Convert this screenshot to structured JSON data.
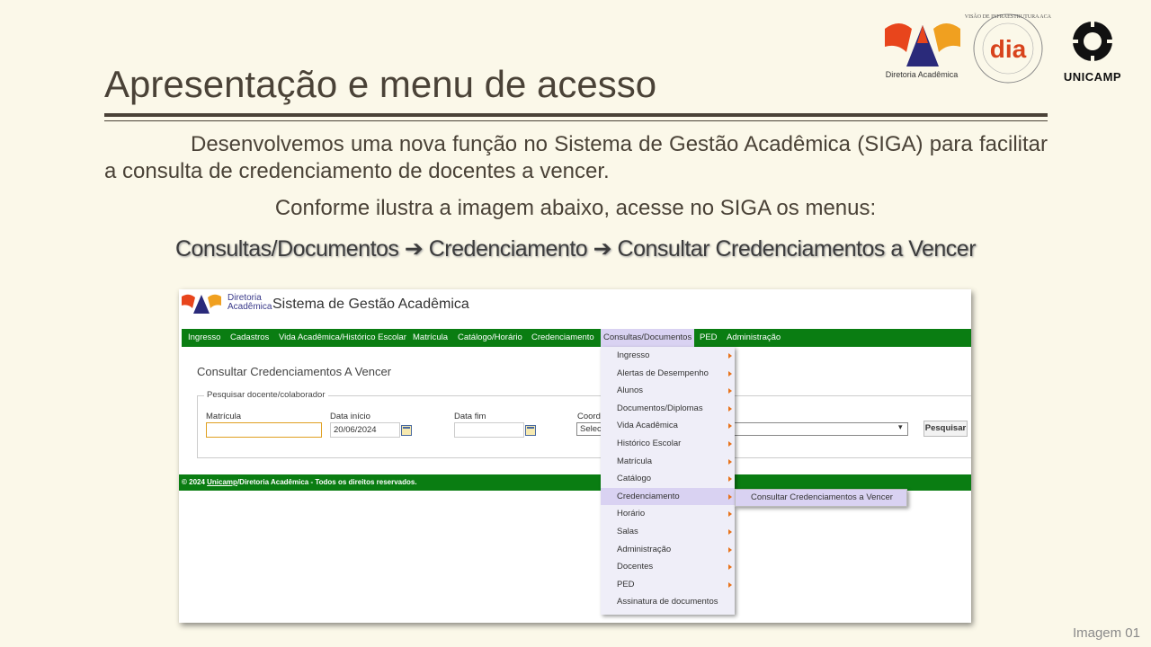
{
  "slide": {
    "title": "Apresentação e menu de acesso",
    "paragraph": "Desenvolvemos uma nova função no Sistema de Gestão Acadêmica (SIGA) para facilitar a consulta de credenciamento de docentes a vencer.",
    "conforme": "Conforme ilustra a imagem abaixo, acesse no SIGA os menus:",
    "path": "Consultas/Documentos ➔ Credenciamento ➔ Consultar Credenciamentos a Vencer",
    "caption": "Imagem 01"
  },
  "logos": {
    "diretoria_label": "Diretoria Acadêmica",
    "dia_label": "dia",
    "dia_ring": "D.I.A. · DIVISÃO DE INFRAESTRUTURA ACADÊMICA ·",
    "unicamp_label": "UNICAMP"
  },
  "app": {
    "logo_line1": "Diretoria",
    "logo_line2": "Acadêmica",
    "title": "Sistema de Gestão Acadêmica",
    "menu": [
      "Ingresso",
      "Cadastros",
      "Vida Acadêmica/Histórico Escolar",
      "Matrícula",
      "Catálogo/Horário",
      "Credenciamento",
      "Consultas/Documentos",
      "PED",
      "Administração"
    ],
    "page_heading": "Consultar Credenciamentos A Vencer",
    "legend": "Pesquisar docente/colaborador",
    "fields": {
      "matricula_label": "Matrícula",
      "matricula_value": "",
      "data_inicio_label": "Data início",
      "data_inicio_value": "20/06/2024",
      "data_fim_label": "Data fim",
      "data_fim_value": "",
      "coord_label": "Coord",
      "coord_value": "Selec"
    },
    "search_button": "Pesquisar",
    "footer_prefix": "© 2024 ",
    "footer_link": "Unicamp",
    "footer_suffix": "/Diretoria Acadêmica - Todos os direitos reservados.",
    "dropdown": [
      "Ingresso",
      "Alertas de Desempenho",
      "Alunos",
      "Documentos/Diplomas",
      "Vida Acadêmica",
      "Histórico Escolar",
      "Matrícula",
      "Catálogo",
      "Credenciamento",
      "Horário",
      "Salas",
      "Administração",
      "Docentes",
      "PED",
      "Assinatura de documentos"
    ],
    "submenu_item": "Consultar Credenciamentos a Vencer"
  },
  "colors": {
    "menubar_green": "#0a7d12",
    "menu_highlight": "#d9d2f2",
    "slide_bg": "#fbf8e9"
  }
}
